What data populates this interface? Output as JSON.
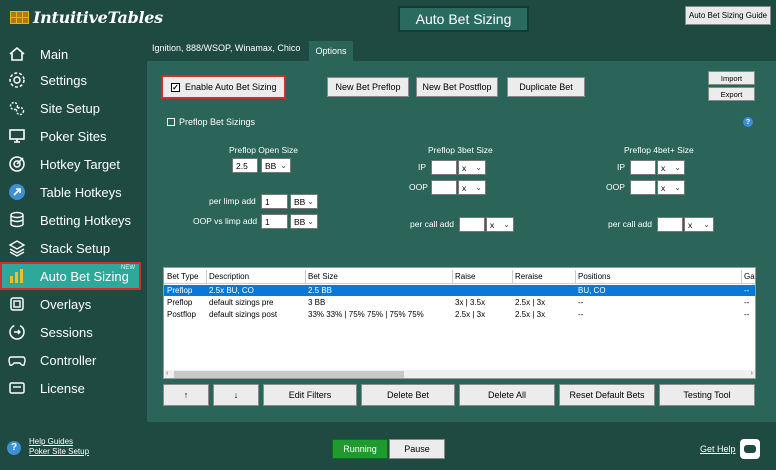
{
  "app": {
    "name": "IntuitiveTables",
    "page_title": "Auto Bet Sizing",
    "guide_button": "Auto Bet Sizing Guide"
  },
  "sidebar": {
    "items": [
      {
        "label": "Main",
        "icon": "home-icon"
      },
      {
        "label": "Settings",
        "icon": "gear-icon"
      },
      {
        "label": "Site Setup",
        "icon": "gears-icon"
      },
      {
        "label": "Poker Sites",
        "icon": "monitor-icon"
      },
      {
        "label": "Hotkey Target",
        "icon": "target-icon"
      },
      {
        "label": "Table Hotkeys",
        "icon": "arrow-circle-icon"
      },
      {
        "label": "Betting Hotkeys",
        "icon": "chips-icon"
      },
      {
        "label": "Stack Setup",
        "icon": "stack-icon"
      },
      {
        "label": "Auto Bet Sizing",
        "icon": "bar-chart-icon",
        "badge": "NEW",
        "active": true
      },
      {
        "label": "Overlays",
        "icon": "overlay-icon"
      },
      {
        "label": "Sessions",
        "icon": "sessions-icon"
      },
      {
        "label": "Controller",
        "icon": "gamepad-icon"
      },
      {
        "label": "License",
        "icon": "license-icon"
      }
    ],
    "help_links": [
      "Help Guides",
      "Poker Site Setup"
    ]
  },
  "main": {
    "sites_label": "Ignition, 888/WSOP, Winamax, Chico",
    "options_tab": "Options",
    "enable_label": "Enable Auto Bet Sizing",
    "enable_checked": true,
    "buttons": {
      "new_preflop": "New Bet Preflop",
      "new_postflop": "New Bet Postflop",
      "duplicate": "Duplicate Bet",
      "import": "Import",
      "export": "Export"
    },
    "preflop_header": "Preflop Bet Sizings",
    "open_size": {
      "title": "Preflop Open Size",
      "value": "2.5",
      "unit": "BB",
      "per_limp_label": "per limp add",
      "per_limp_value": "1",
      "per_limp_unit": "BB",
      "oop_limp_label": "OOP vs limp add",
      "oop_limp_value": "1",
      "oop_limp_unit": "BB"
    },
    "threebet": {
      "title": "Preflop 3bet Size",
      "ip_label": "IP",
      "ip_value": "",
      "ip_unit": "x",
      "oop_label": "OOP",
      "oop_value": "",
      "oop_unit": "x",
      "call_label": "per call add",
      "call_value": "",
      "call_unit": "x"
    },
    "fourbet": {
      "title": "Preflop 4bet+ Size",
      "ip_label": "IP",
      "ip_value": "",
      "ip_unit": "x",
      "oop_label": "OOP",
      "oop_value": "",
      "oop_unit": "x",
      "call_label": "per call add",
      "call_value": "",
      "call_unit": "x"
    },
    "table": {
      "headers": [
        "Bet Type",
        "Description",
        "Bet Size",
        "Raise",
        "Reraise",
        "Positions",
        "Ga"
      ],
      "rows": [
        [
          "Preflop",
          "2.5x BU, CO",
          "2.5 BB",
          "",
          "",
          "BU, CO",
          "--"
        ],
        [
          "Preflop",
          "default sizings pre",
          "3 BB",
          "3x | 3.5x",
          "2.5x | 3x",
          "--",
          "--"
        ],
        [
          "Postflop",
          "default sizings post",
          "33% 33% | 75% 75% | 75% 75%",
          "2.5x | 3x",
          "2.5x | 3x",
          "--",
          "--"
        ]
      ]
    },
    "bottom_buttons": {
      "up": "↑",
      "down": "↓",
      "edit_filters": "Edit Filters",
      "delete_bet": "Delete Bet",
      "delete_all": "Delete All",
      "reset": "Reset Default Bets",
      "testing": "Testing Tool"
    }
  },
  "footer": {
    "running": "Running",
    "pause": "Pause",
    "get_help": "Get Help"
  },
  "colors": {
    "background": "#1e4a42",
    "panel": "#2b6459",
    "accent": "#2ea89a",
    "highlight": "#d42b2b",
    "running": "#1e9a2e",
    "selected_row": "#0a78d7"
  }
}
